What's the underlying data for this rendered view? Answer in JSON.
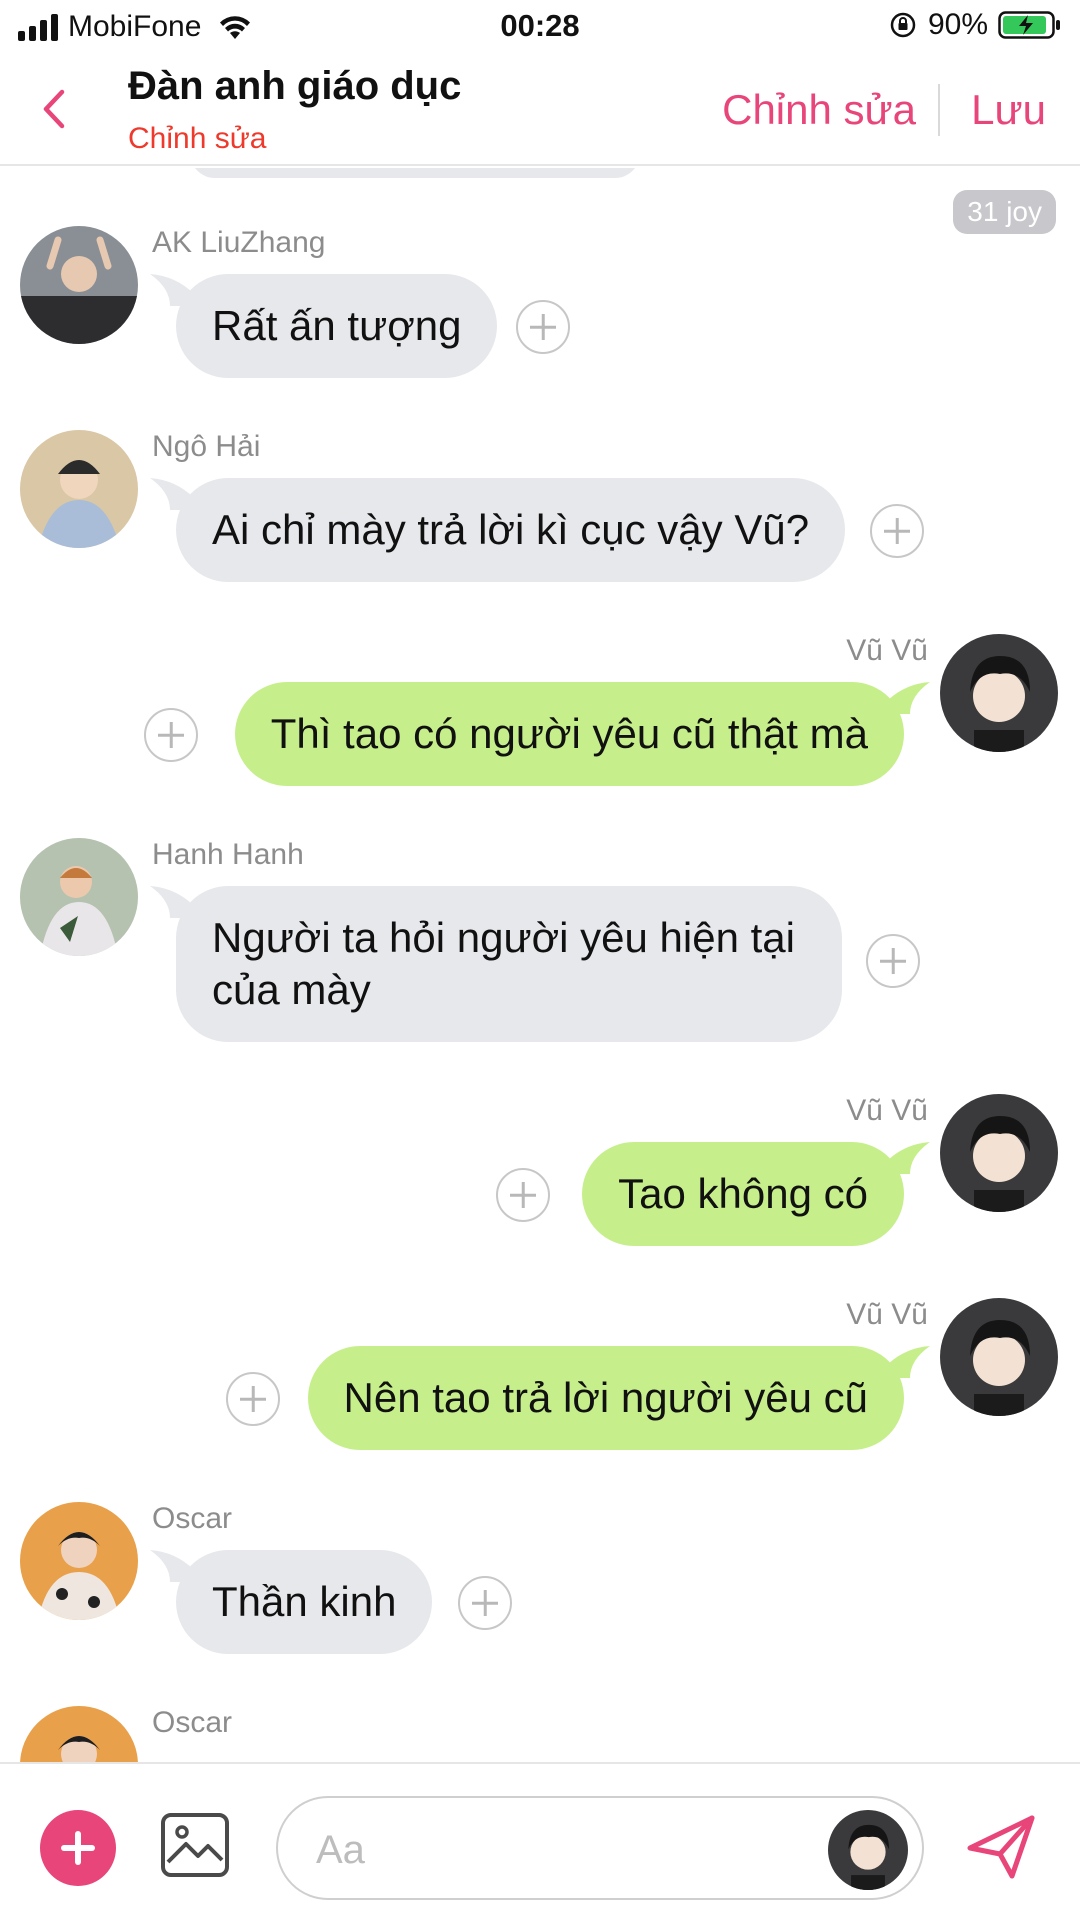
{
  "status_bar": {
    "carrier": "MobiFone",
    "time": "00:28",
    "battery": "90%"
  },
  "header": {
    "title": "Đàn anh giáo dục",
    "subtitle": "Chỉnh sửa",
    "edit_label": "Chỉnh sửa",
    "save_label": "Lưu"
  },
  "chat": {
    "time_badge": "31 joy",
    "messages": [
      {
        "sender": "AK LiuZhang",
        "direction": "in",
        "text": "Rất ấn tượng"
      },
      {
        "sender": "Ngô Hải",
        "direction": "in",
        "text": "Ai chỉ mày trả lời kì cục vậy Vũ?"
      },
      {
        "sender": "Vũ Vũ",
        "direction": "out",
        "text": "Thì tao có người yêu cũ thật mà"
      },
      {
        "sender": "Hanh Hanh",
        "direction": "in",
        "text": "Người ta hỏi người yêu hiện tại của mày"
      },
      {
        "sender": "Vũ Vũ",
        "direction": "out",
        "text": "Tao không có"
      },
      {
        "sender": "Vũ Vũ",
        "direction": "out",
        "text": "Nên tao trả lời người yêu cũ"
      },
      {
        "sender": "Oscar",
        "direction": "in",
        "text": "Thần kinh"
      },
      {
        "sender": "Oscar",
        "direction": "in",
        "text": ""
      }
    ]
  },
  "composer": {
    "placeholder": "Aa"
  },
  "colors": {
    "accent": "#e8457a",
    "subtitle": "#ee3a2c",
    "incoming_bubble": "#e7e8ec",
    "outgoing_bubble": "#c6ef8c"
  },
  "icons": {
    "back": "chevron-left-icon",
    "add": "plus-circle-icon",
    "image": "image-icon",
    "send": "paper-plane-icon"
  }
}
